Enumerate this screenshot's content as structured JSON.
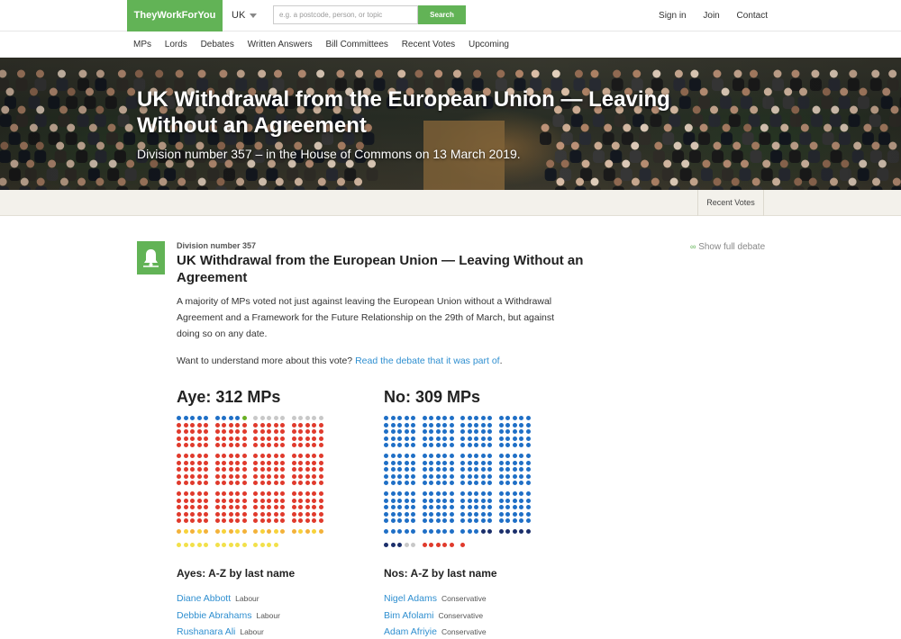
{
  "header": {
    "logo": "TheyWorkForYou",
    "country": "UK",
    "search_placeholder": "e.g. a postcode, person, or topic",
    "search_button": "Search",
    "links": [
      "Sign in",
      "Join",
      "Contact"
    ]
  },
  "nav": {
    "items": [
      "MPs",
      "Lords",
      "Debates",
      "Written Answers",
      "Bill Committees",
      "Recent Votes",
      "Upcoming"
    ]
  },
  "hero": {
    "title": "UK Withdrawal from the European Union — Leaving Without an Agreement",
    "subtitle": "Division number 357 – in the House of Commons on 13 March 2019."
  },
  "tabs": {
    "recent_votes": "Recent Votes"
  },
  "division": {
    "number_label": "Division number 357",
    "title": "UK Withdrawal from the European Union — Leaving Without an Agreement",
    "show_full_debate": "Show full debate",
    "summary": "A majority of MPs voted not just against leaving the European Union without a Withdrawal Agreement and a Framework for the Future Relationship on the 29th of March, but against doing so on any date.",
    "understand_prefix": "Want to understand more about this vote?",
    "understand_link": "Read the debate that it was part of",
    "understand_suffix": "."
  },
  "results": {
    "aye_heading": "Aye: 312 MPs",
    "no_heading": "No: 309 MPs",
    "ayes_list_heading": "Ayes: A-Z by last name",
    "nos_list_heading": "Nos: A-Z by last name",
    "ayes": [
      {
        "name": "Diane Abbott",
        "party": "Labour"
      },
      {
        "name": "Debbie Abrahams",
        "party": "Labour"
      },
      {
        "name": "Rushanara Ali",
        "party": "Labour"
      }
    ],
    "nos": [
      {
        "name": "Nigel Adams",
        "party": "Conservative"
      },
      {
        "name": "Bim Afolami",
        "party": "Conservative"
      },
      {
        "name": "Adam Afriyie",
        "party": "Conservative"
      }
    ]
  },
  "colors": {
    "brand_green": "#62b356",
    "link_blue": "#2f8fd0",
    "labour": "#e03a2c",
    "conservative": "#1f6fc6",
    "libdem": "#f2cf2f",
    "snp": "#f1e55a",
    "green_party": "#6ab023",
    "independent": "#c8c8c8",
    "dup": "#1b2f6b",
    "plaid": "#3bb273"
  },
  "dot_colors": {
    "conservative": "#1f6fc6",
    "labour": "#e03a2c",
    "libdem": "#f3b23a",
    "snp": "#f2e04a",
    "green_party": "#6ab023",
    "independent": "#c8c8c8",
    "dup": "#1b2f6b"
  }
}
